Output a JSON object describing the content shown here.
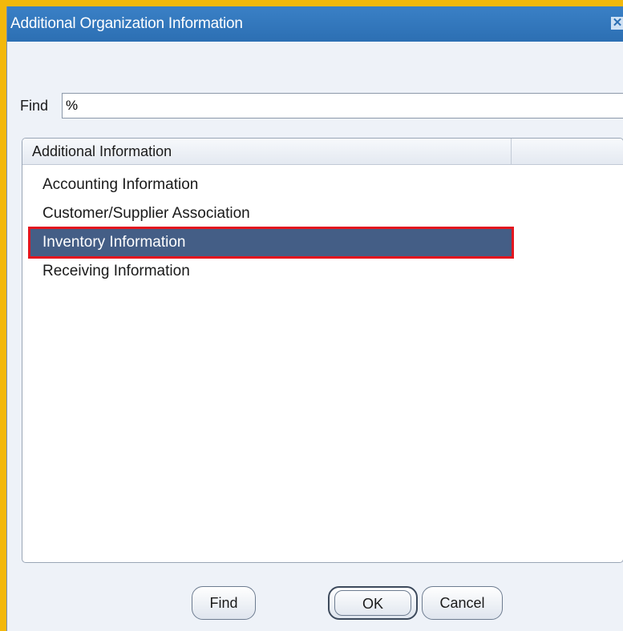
{
  "window": {
    "title": "Additional Organization Information",
    "close_icon": "close-icon"
  },
  "find_row": {
    "label": "Find",
    "value": "%"
  },
  "list": {
    "header": "Additional Information",
    "items": [
      {
        "label": "Accounting Information",
        "selected": false
      },
      {
        "label": "Customer/Supplier Association",
        "selected": false
      },
      {
        "label": "Inventory Information",
        "selected": true
      },
      {
        "label": "Receiving Information",
        "selected": false
      }
    ]
  },
  "buttons": {
    "find": "Find",
    "ok": "OK",
    "cancel": "Cancel"
  },
  "colors": {
    "titlebar": "#2c6fb3",
    "selection": "#445e86",
    "highlight_outline": "#e3161f",
    "background": "#f3b80b"
  }
}
